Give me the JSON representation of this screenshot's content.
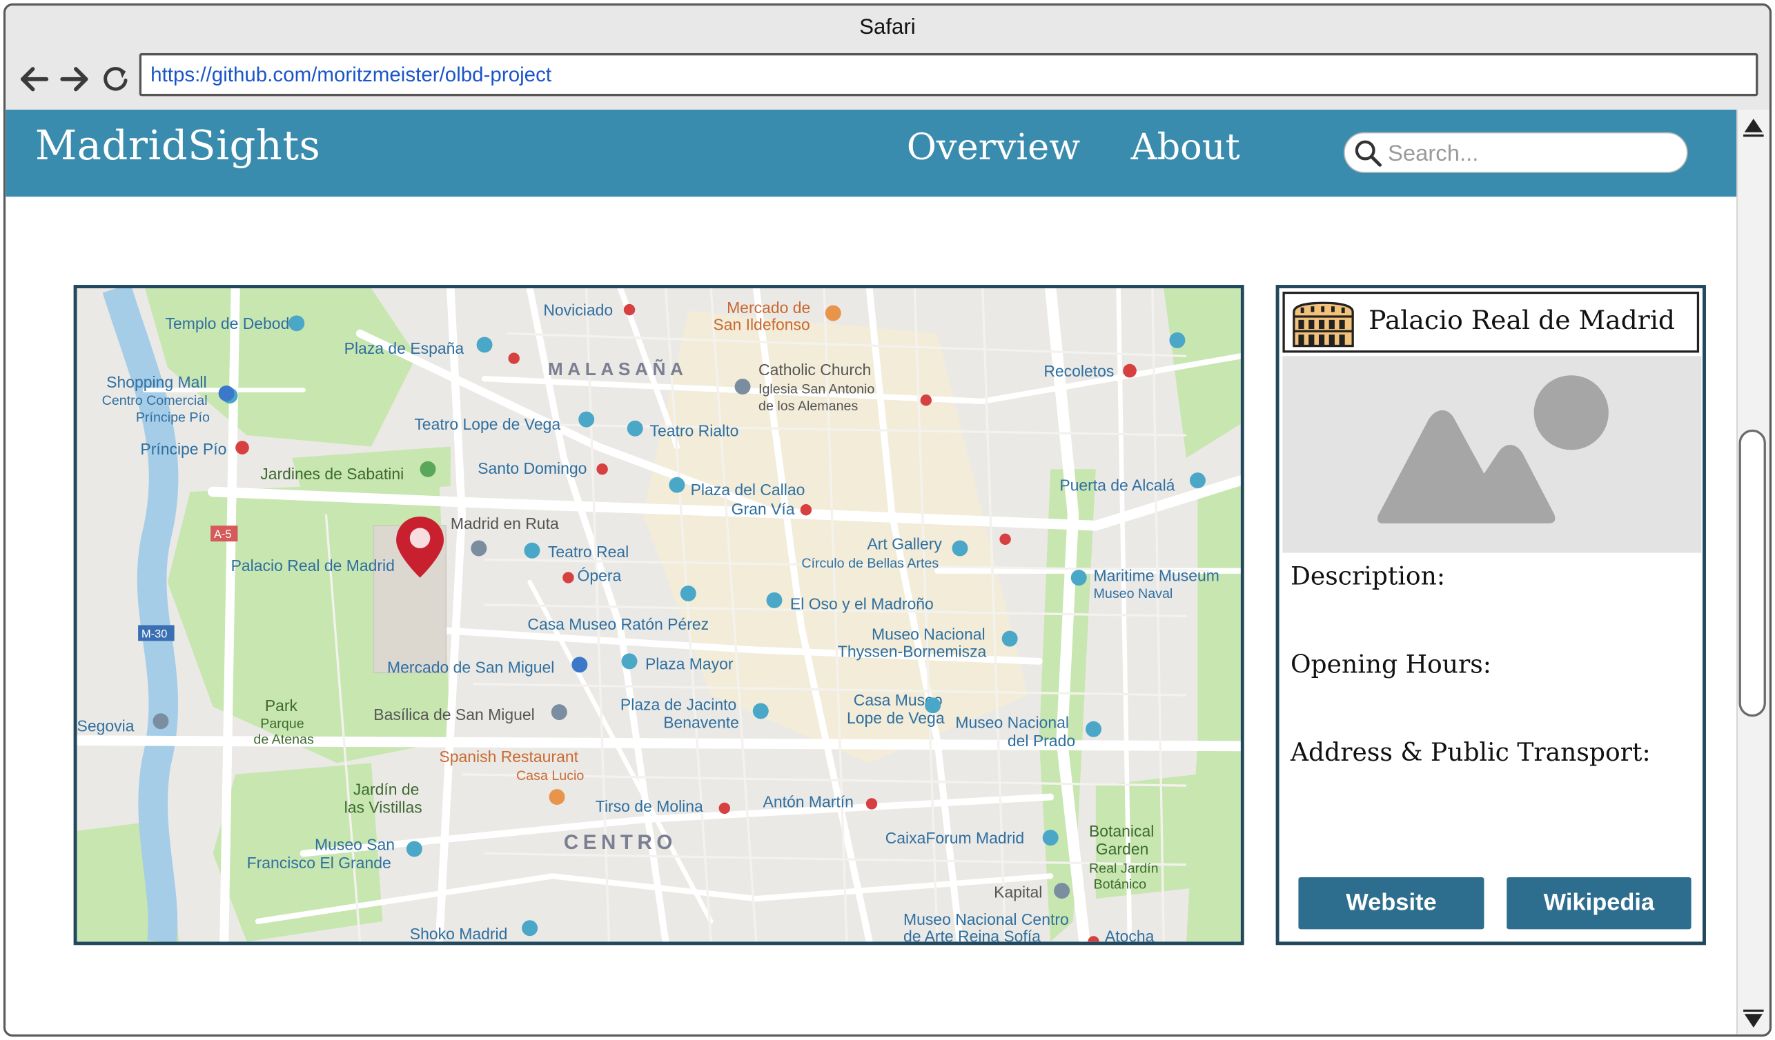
{
  "browser": {
    "title": "Safari",
    "url": "https://github.com/moritzmeister/olbd-project"
  },
  "app": {
    "brand": "MadridSights",
    "nav": [
      "Overview",
      "About"
    ],
    "search_placeholder": "Search..."
  },
  "map": {
    "marker_label": "Palacio Real de Madrid",
    "labels": [
      "Templo de Debod",
      "Plaza de España",
      "Noviciado",
      "Mercado de",
      "San Ildefonso",
      "MALASAÑA",
      "Catholic Church",
      "Iglesia San Antonio",
      "de los Alemanes",
      "Recoletos",
      "Shopping Mall",
      "Centro Comercial",
      "Príncipe Pío",
      "Príncipe Pío",
      "Teatro Lope de Vega",
      "Teatro Rialto",
      "Jardines de Sabatini",
      "Santo Domingo",
      "Plaza del Callao",
      "Gran Vía",
      "Puerta de Alcalá",
      "Madrid en Ruta",
      "Teatro Real",
      "Ópera",
      "Art Gallery",
      "Círculo de Bellas Artes",
      "Maritime Museum",
      "Museo Naval",
      "El Oso y el Madroño",
      "Casa Museo Ratón Pérez",
      "Museo Nacional",
      "Thyssen-Bornemisza",
      "Mercado de San Miguel",
      "Plaza Mayor",
      "Park",
      "Parque",
      "de Atenas",
      "Basílica de San Miguel",
      "Plaza de Jacinto",
      "Benavente",
      "Casa Museo",
      "Lope de Vega",
      "Museo Nacional",
      "del Prado",
      "Spanish Restaurant",
      "Casa Lucio",
      "Jardín de",
      "las Vistillas",
      "Tirso de Molina",
      "Antón Martín",
      "CENTRO",
      "CaixaForum Madrid",
      "Botanical",
      "Garden",
      "Real Jardín",
      "Botánico",
      "Museo San",
      "Francisco El Grande",
      "Kapital",
      "Museo Nacional Centro",
      "de Arte Reina Sofía",
      "Shoko Madrid",
      "Atocha",
      "Segovia",
      "A-5",
      "M-30"
    ]
  },
  "panel": {
    "title": "Palacio Real de Madrid",
    "description_label": "Description:",
    "hours_label": "Opening Hours:",
    "address_label": "Address & Public Transport:",
    "website_button": "Website",
    "wikipedia_button": "Wikipedia"
  },
  "colors": {
    "appbar": "#3a8cae",
    "panel_border": "#21485c",
    "button": "#2d6e8e",
    "marker": "#c8202f"
  },
  "icons": {
    "back": "arrow-left-icon",
    "forward": "arrow-right-icon",
    "reload": "reload-icon",
    "search": "search-icon",
    "landmark": "colosseum-icon",
    "image": "image-placeholder-icon",
    "marker": "map-pin-icon"
  }
}
